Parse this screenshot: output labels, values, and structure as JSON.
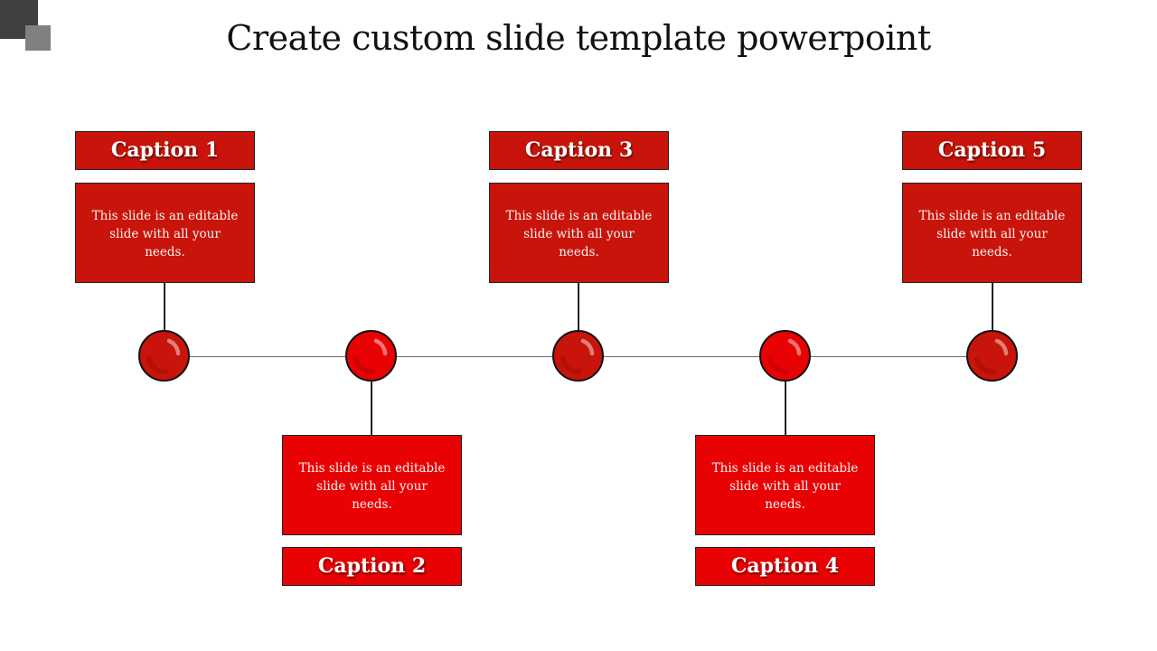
{
  "title": "Create custom slide template powerpoint",
  "colors": {
    "dark_red": "#c8140a",
    "bright_red": "#e80203",
    "line": "#6b6b6b",
    "deco_dark": "#404040",
    "deco_light": "#808080"
  },
  "timeline": {
    "items": [
      {
        "caption": "Caption 1",
        "text": "This slide is an editable slide with all your needs.",
        "position": "top",
        "tone": "dark"
      },
      {
        "caption": "Caption 2",
        "text": "This slide is an editable slide with all your needs.",
        "position": "bottom",
        "tone": "bright"
      },
      {
        "caption": "Caption 3",
        "text": "This slide is an editable slide with all your needs.",
        "position": "top",
        "tone": "dark"
      },
      {
        "caption": "Caption 4",
        "text": "This slide is an editable slide with all your needs.",
        "position": "bottom",
        "tone": "bright"
      },
      {
        "caption": "Caption 5",
        "text": "This slide is an editable slide with all your needs.",
        "position": "top",
        "tone": "dark"
      }
    ]
  }
}
